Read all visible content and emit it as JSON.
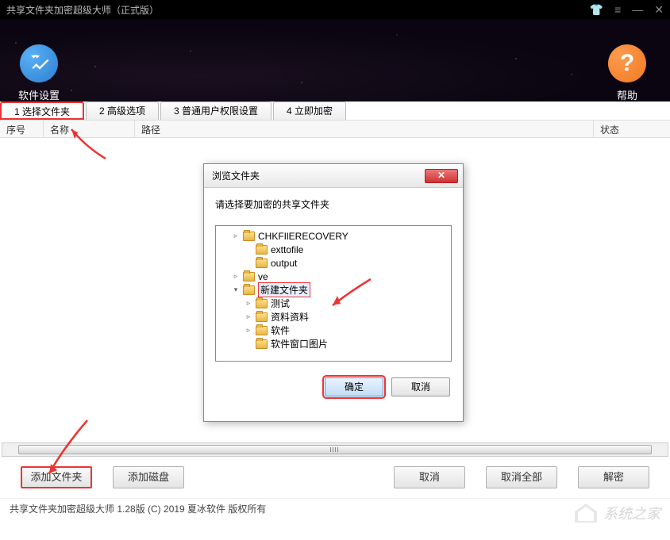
{
  "window": {
    "title": "共享文件夹加密超级大师（正式版）"
  },
  "toolbar": {
    "settings_label": "软件设置",
    "help_label": "帮助",
    "settings_glyph": "✖",
    "help_glyph": "?"
  },
  "tabs": [
    {
      "label": "1 选择文件夹",
      "active": true
    },
    {
      "label": "2 高级选项"
    },
    {
      "label": "3 普通用户权限设置"
    },
    {
      "label": "4 立即加密"
    }
  ],
  "columns": {
    "num": "序号",
    "name": "名称",
    "path": "路径",
    "status": "状态"
  },
  "buttons": {
    "add_folder": "添加文件夹",
    "add_disk": "添加磁盘",
    "cancel": "取消",
    "cancel_all": "取消全部",
    "decrypt": "解密"
  },
  "status": "共享文件夹加密超级大师 1.28版  (C) 2019 夏冰软件 版权所有",
  "dialog": {
    "title": "浏览文件夹",
    "subtitle": "请选择要加密的共享文件夹",
    "tree": [
      {
        "expand": "▹",
        "indent": 1,
        "label": "CHKFIlERECOVERY"
      },
      {
        "expand": "",
        "indent": 2,
        "label": "exttofile"
      },
      {
        "expand": "",
        "indent": 2,
        "label": "output"
      },
      {
        "expand": "▹",
        "indent": 1,
        "label": "ve"
      },
      {
        "expand": "▾",
        "indent": 1,
        "label": "新建文件夹",
        "selected": true,
        "hl": true
      },
      {
        "expand": "▹",
        "indent": 2,
        "label": "测试"
      },
      {
        "expand": "▹",
        "indent": 2,
        "label": "资料资料"
      },
      {
        "expand": "▹",
        "indent": 2,
        "label": "软件"
      },
      {
        "expand": "",
        "indent": 2,
        "label": "软件窗口图片"
      }
    ],
    "ok": "确定",
    "cancel": "取消"
  },
  "watermark": {
    "text": "系统之家"
  }
}
